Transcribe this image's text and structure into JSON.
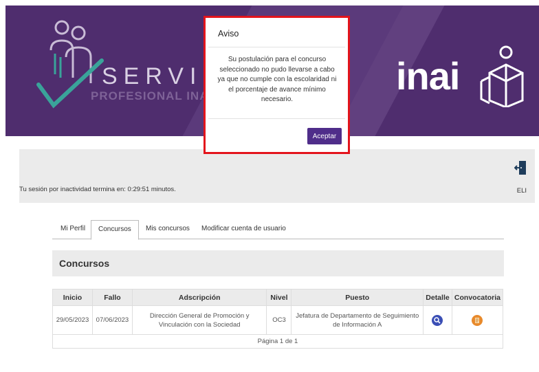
{
  "header": {
    "logo_title": "SERVICIO",
    "logo_subtitle": "PROFESIONAL INAI",
    "brand": "inai",
    "colors": {
      "background": "#4f2d6e",
      "accent_teal": "#3aa39a"
    }
  },
  "session": {
    "inactivity_text": "Tu sesión por inactividad termina en: 0:29:51 minutos.",
    "exit_label": "ELI",
    "exit_icon": "exit-door-icon"
  },
  "tabs": [
    {
      "label": "Mi Perfil",
      "active": false
    },
    {
      "label": "Concursos",
      "active": true
    },
    {
      "label": "Mis concursos",
      "active": false
    },
    {
      "label": "Modificar cuenta de usuario",
      "active": false
    }
  ],
  "section": {
    "title": "Concursos"
  },
  "table": {
    "headers": [
      "Inicio",
      "Fallo",
      "Adscripción",
      "Nivel",
      "Puesto",
      "Detalle",
      "Convocatoria"
    ],
    "rows": [
      {
        "inicio": "29/05/2023",
        "fallo": "07/06/2023",
        "adscripcion": "Dirección General de Promoción y Vinculación con la Sociedad",
        "nivel": "OC3",
        "puesto": "Jefatura de Departamento de Seguimiento de Información A",
        "detalle_icon": "magnifier-icon",
        "convocatoria_icon": "document-icon"
      }
    ],
    "pager": "Página 1 de 1"
  },
  "modal": {
    "title": "Aviso",
    "message": "Su postulación para el concurso seleccionado no pudo llevarse a cabo ya que no cumple con la escolaridad ni el porcentaje de avance mínimo necesario.",
    "button_label": "Aceptar",
    "highlight_color": "#e3141c",
    "button_color": "#4f2d8a"
  }
}
